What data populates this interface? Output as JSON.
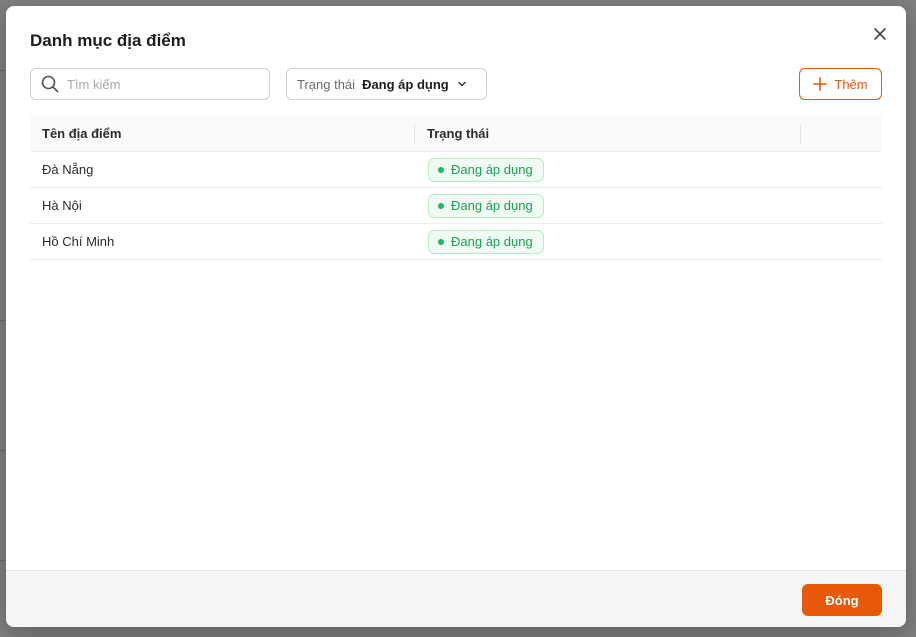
{
  "modal": {
    "title": "Danh mục địa điểm",
    "close_icon": "close-icon"
  },
  "toolbar": {
    "search": {
      "placeholder": "Tìm kiếm",
      "value": "",
      "icon": "search-icon"
    },
    "status_filter": {
      "label": "Trạng thái",
      "value": "Đang áp dụng",
      "icon": "chevron-down-icon"
    },
    "add_button": {
      "label": "Thêm",
      "icon": "plus-icon"
    }
  },
  "table": {
    "columns": [
      "Tên địa điểm",
      "Trạng thái",
      ""
    ],
    "rows": [
      {
        "name": "Đà Nẵng",
        "status": "Đang áp dụng"
      },
      {
        "name": "Hà Nội",
        "status": "Đang áp dụng"
      },
      {
        "name": "Hồ Chí Minh",
        "status": "Đang áp dụng"
      }
    ]
  },
  "footer": {
    "close_label": "Đóng"
  },
  "colors": {
    "accent": "#e8590c",
    "status_active_text": "#1f9d55",
    "status_active_bg": "#f0fbf4",
    "status_active_border": "#b7ebc9"
  }
}
